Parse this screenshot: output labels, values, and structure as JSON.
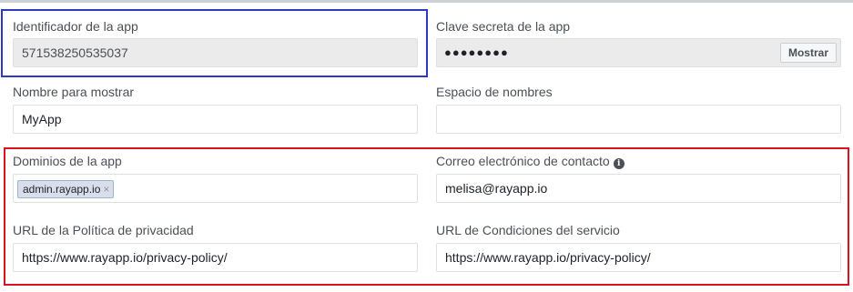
{
  "app_id": {
    "label": "Identificador de la app",
    "value": "571538250535037"
  },
  "app_secret": {
    "label": "Clave secreta de la app",
    "masked_value": "●●●●●●●●",
    "show_button": "Mostrar"
  },
  "display_name": {
    "label": "Nombre para mostrar",
    "value": "MyApp"
  },
  "namespace": {
    "label": "Espacio de nombres",
    "value": ""
  },
  "app_domains": {
    "label": "Dominios de la app",
    "tags": [
      "admin.rayapp.io"
    ],
    "remove_glyph": "×"
  },
  "contact_email": {
    "label": "Correo electrónico de contacto",
    "info_icon": "info-icon",
    "value": "melisa@rayapp.io"
  },
  "privacy_policy_url": {
    "label": "URL de la Política de privacidad",
    "value": "https://www.rayapp.io/privacy-policy/"
  },
  "terms_url": {
    "label": "URL de Condiciones del servicio",
    "value": "https://www.rayapp.io/privacy-policy/"
  },
  "highlight_colors": {
    "blue": "#2b3ac1",
    "red": "#d9141c"
  }
}
